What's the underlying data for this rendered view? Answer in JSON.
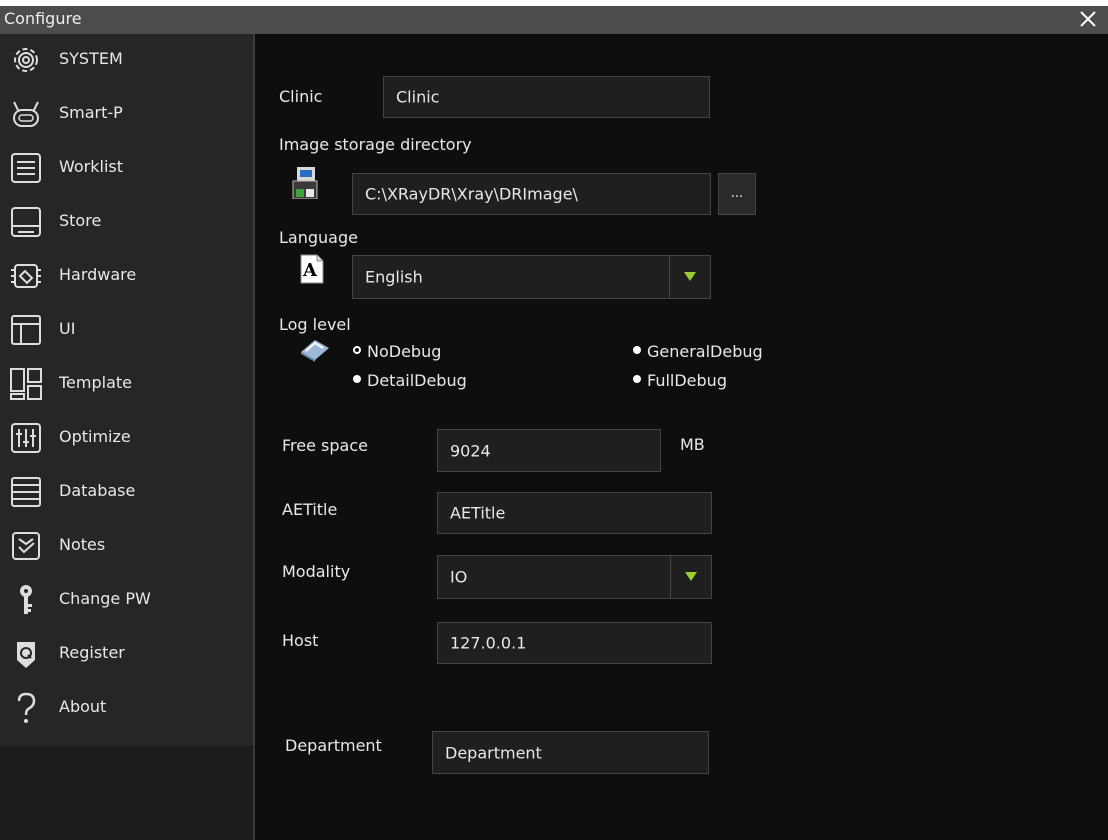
{
  "window": {
    "title": "Configure"
  },
  "sidebar": {
    "items": [
      {
        "label": "SYSTEM",
        "icon": "gear-icon"
      },
      {
        "label": "Smart-P",
        "icon": "robot-icon"
      },
      {
        "label": "Worklist",
        "icon": "list-icon"
      },
      {
        "label": "Store",
        "icon": "storage-icon"
      },
      {
        "label": "Hardware",
        "icon": "hardware-icon"
      },
      {
        "label": "UI",
        "icon": "layout-icon"
      },
      {
        "label": "Template",
        "icon": "template-icon"
      },
      {
        "label": "Optimize",
        "icon": "sliders-icon"
      },
      {
        "label": "Database",
        "icon": "database-icon"
      },
      {
        "label": "Notes",
        "icon": "checklist-icon"
      },
      {
        "label": "Change PW",
        "icon": "key-icon"
      },
      {
        "label": "Register",
        "icon": "register-icon"
      },
      {
        "label": "About",
        "icon": "question-icon"
      }
    ]
  },
  "form": {
    "clinic": {
      "label": "Clinic",
      "value": "Clinic"
    },
    "storage": {
      "label": "Image storage directory",
      "value": "C:\\XRayDR\\Xray\\DRImage\\",
      "browse_label": "..."
    },
    "language": {
      "label": "Language",
      "value": "English"
    },
    "log": {
      "label": "Log level",
      "options": [
        "NoDebug",
        "GeneralDebug",
        "DetailDebug",
        "FullDebug"
      ],
      "selected": "NoDebug"
    },
    "free_space": {
      "label": "Free space",
      "value": "9024",
      "unit": "MB"
    },
    "aetitle": {
      "label": "AETitle",
      "value": "AETitle"
    },
    "modality": {
      "label": "Modality",
      "value": "IO"
    },
    "host": {
      "label": "Host",
      "value": "127.0.0.1"
    },
    "department": {
      "label": "Department",
      "value": "Department"
    }
  },
  "colors": {
    "accent": "#9acd32",
    "background": "#0e0e0e",
    "sidebar": "#262626"
  }
}
